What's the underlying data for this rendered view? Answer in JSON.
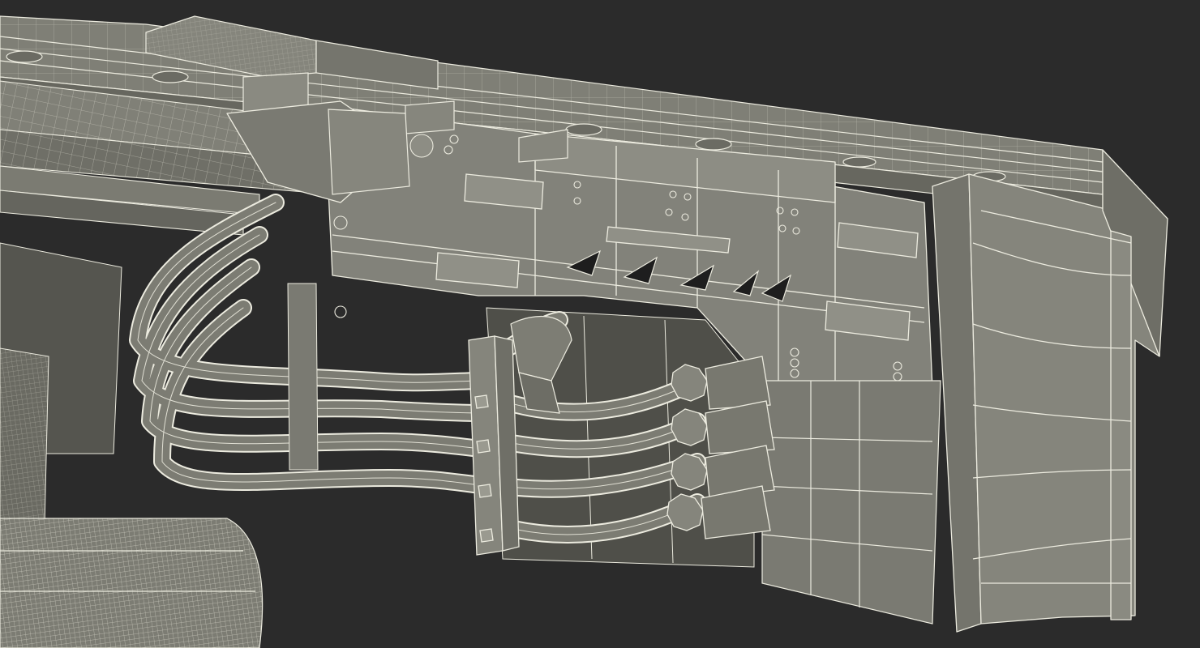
{
  "scene": {
    "background_color": "#2b2b2b",
    "mesh_fill_color": "#7c7c72",
    "mesh_fill_dark": "#66665d",
    "mesh_fill_light": "#8e8e84",
    "wire_color": "#ecebdf",
    "shadow_color": "#3c3c37"
  }
}
